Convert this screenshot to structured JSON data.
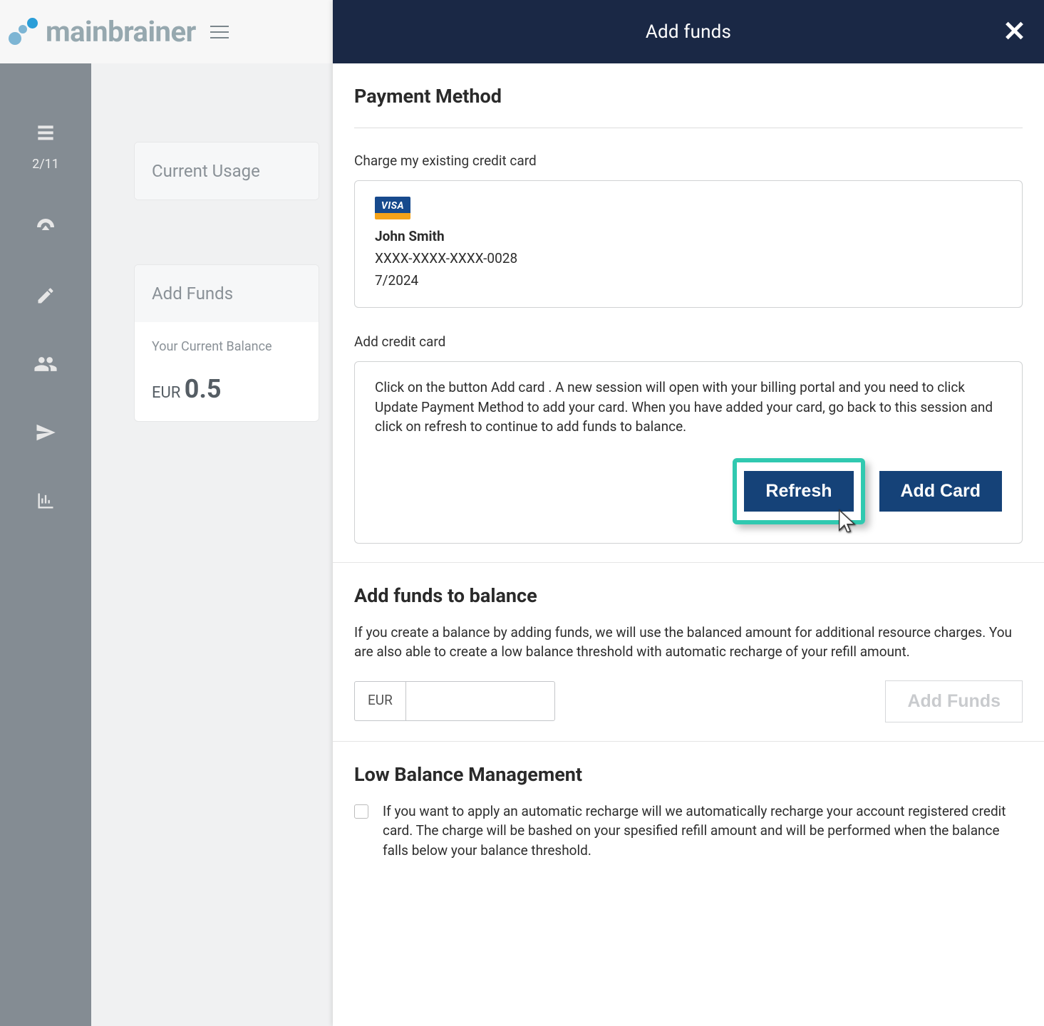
{
  "brand": {
    "name": "mainbrainer"
  },
  "sidebar": {
    "progress": "2/11"
  },
  "bg": {
    "tab_current_usage": "Current Usage",
    "add_funds_title": "Add Funds",
    "balance_label": "Your Current Balance",
    "balance_currency": "EUR",
    "balance_value": "0.5"
  },
  "modal": {
    "title": "Add funds",
    "payment_method_heading": "Payment Method",
    "charge_existing_label": "Charge my existing credit card",
    "card": {
      "brand": "VISA",
      "holder": "John Smith",
      "masked": "XXXX-XXXX-XXXX-0028",
      "expiry": "7/2024"
    },
    "add_card_label": "Add credit card",
    "add_card_help": "Click on the button Add card . A new session will open with your billing portal and you need to click Update Payment Method to add your card. When you have added your card, go back to this session and click on refresh to continue to add funds to balance.",
    "refresh_btn": "Refresh",
    "add_card_btn": "Add Card",
    "add_funds_heading": "Add funds to balance",
    "add_funds_desc": "If you create a balance by adding funds, we will use the balanced amount for additional resource charges. You are also able to create a low balance threshold with automatic recharge of your refill amount.",
    "amount_currency": "EUR",
    "add_funds_btn": "Add Funds",
    "low_balance_heading": "Low Balance Management",
    "low_balance_desc": "If you want to apply an automatic recharge will we automatically recharge your account registered credit card. The charge will be bashed on your spesified refill amount and will be performed when the balance falls below your balance threshold."
  }
}
